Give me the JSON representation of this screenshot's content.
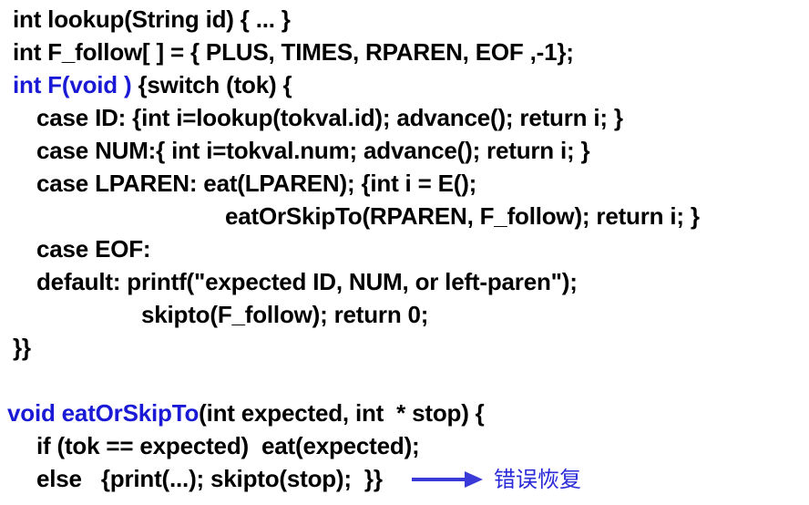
{
  "code": {
    "line1": "int lookup(String id) { ... }",
    "line2": "int F_follow[ ] = { PLUS, TIMES, RPAREN, EOF ,-1};",
    "line3_sig": "int F(void )",
    "line3_rest": " {switch (tok) {",
    "line4": "case ID: {int i=lookup(tokval.id); advance(); return i; }",
    "line5": "case NUM:{ int i=tokval.num; advance(); return i; }",
    "line6": "case LPAREN: eat(LPAREN); {int i = E();",
    "line7": "eatOrSkipTo(RPAREN, F_follow); return i; }",
    "line8": "case EOF:",
    "line9": "default: printf(\"expected ID, NUM, or left-paren\");",
    "line10": "skipto(F_follow); return 0;",
    "line11": "}}",
    "line12_sig": "void eatOrSkipTo",
    "line12_rest": "(int expected, int  * stop) {",
    "line13": "if (tok == expected)  eat(expected);",
    "line14": "else   {print(...); skipto(stop);  }}"
  },
  "annotation": {
    "label": "错误恢复",
    "color": "#2a2ad8"
  }
}
